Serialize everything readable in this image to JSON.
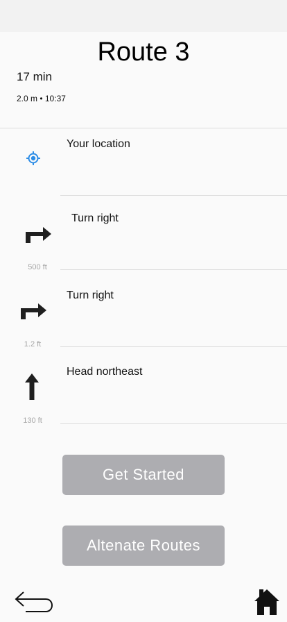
{
  "header": {
    "title": "Route 3",
    "duration": "17 min",
    "details": "2.0 m • 10:37"
  },
  "steps": [
    {
      "instruction": "Your location",
      "distance": "",
      "icon": "location-target-icon"
    },
    {
      "instruction": "Turn right",
      "distance": "500 ft",
      "icon": "turn-right-arrow-icon"
    },
    {
      "instruction": "Turn right",
      "distance": "1.2 ft",
      "icon": "turn-right-arrow-icon"
    },
    {
      "instruction": "Head northeast",
      "distance": "130 ft",
      "icon": "straight-up-arrow-icon"
    }
  ],
  "actions": {
    "get_started": "Get Started",
    "alternate_routes": "Altenate Routes"
  },
  "footer": {
    "back_icon": "back-arrow-icon",
    "home_icon": "home-icon"
  },
  "colors": {
    "accent": "#2d8de6",
    "button_bg": "#adadb1",
    "icon": "#1f1f1f",
    "distance_text": "#a6a6a6"
  }
}
